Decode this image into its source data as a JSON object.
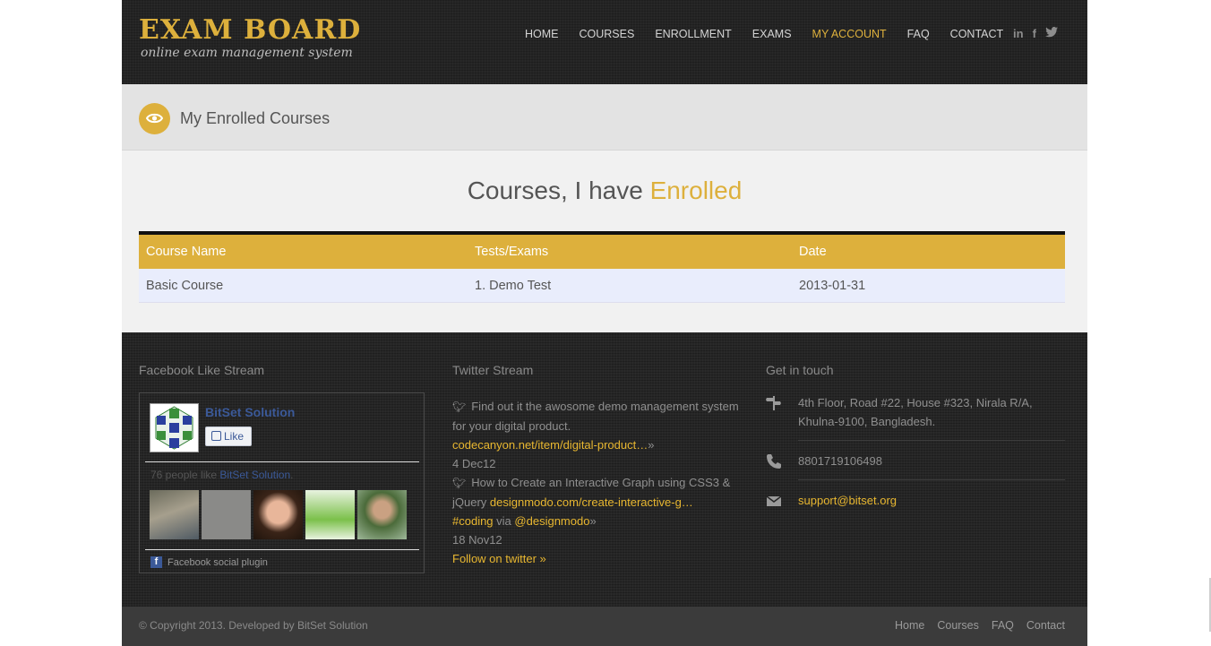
{
  "brand": {
    "title": "EXAM BOARD",
    "subtitle": "online exam management system"
  },
  "nav": {
    "items": [
      {
        "label": "HOME"
      },
      {
        "label": "COURSES"
      },
      {
        "label": "ENROLLMENT"
      },
      {
        "label": "EXAMS"
      },
      {
        "label": "MY ACCOUNT"
      },
      {
        "label": "FAQ"
      },
      {
        "label": "CONTACT"
      }
    ],
    "active": "MY ACCOUNT",
    "social": [
      "in",
      "f",
      "t"
    ]
  },
  "page": {
    "title": "My Enrolled Courses",
    "icon": "eye-icon"
  },
  "main": {
    "heading_main": "Courses, I have ",
    "heading_highlight": "Enrolled",
    "table": {
      "headers": [
        "Course Name",
        "Tests/Exams",
        "Date"
      ],
      "rows": [
        [
          "Basic Course",
          "1. Demo Test",
          "2013-01-31"
        ]
      ]
    }
  },
  "footer": {
    "facebook": {
      "title": "Facebook Like Stream",
      "page_name": "BitSet Solution",
      "like_label": "Like",
      "count_text": "76 people like",
      "count_link": "BitSet Solution",
      "count_end": ".",
      "plugin_label": "Facebook social plugin"
    },
    "twitter": {
      "title": "Twitter Stream",
      "tweets": [
        {
          "text": "Find out it the awosome demo management system for your digital product.",
          "link": "codecanyon.net/item/digital-product…",
          "suffix": "»",
          "date": "4 Dec12"
        },
        {
          "text": "How to Create an Interactive Graph using CSS3 & jQuery",
          "link": "designmodo.com/create-interactive-g…",
          "tag": "#coding",
          "via": "via",
          "handle": "@designmodo",
          "suffix": "»",
          "date": "18 Nov12"
        }
      ],
      "follow": "Follow on twitter »"
    },
    "contact": {
      "title": "Get in touch",
      "address": "4th Floor, Road #22, House #323, Nirala R/A, Khulna-9100, Bangladesh.",
      "phone": "8801719106498",
      "email": "support@bitset.org"
    },
    "copyright": "© Copyright 2013. Developed by BitSet Solution",
    "links": [
      "Home",
      "Courses",
      "FAQ",
      "Contact"
    ]
  },
  "colors": {
    "accent": "#ddb03c",
    "header_bg": "#242424",
    "link": "#e8b730",
    "facebook": "#3b5998"
  }
}
